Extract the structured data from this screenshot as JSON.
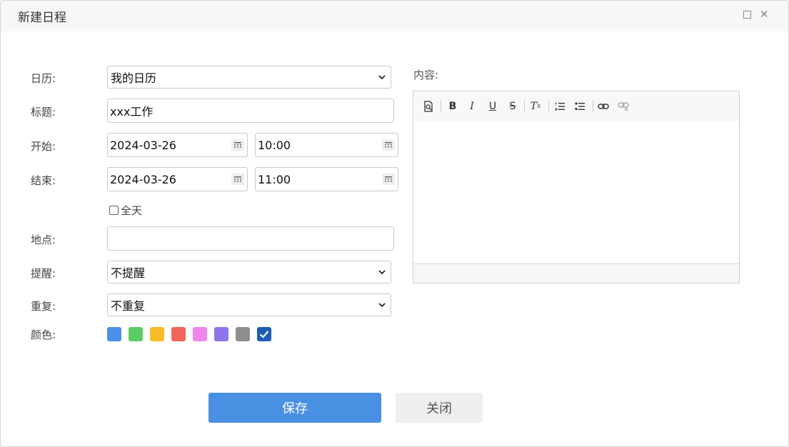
{
  "dialog": {
    "title": "新建日程"
  },
  "form": {
    "calendar": {
      "label": "日历:",
      "value": "我的日历"
    },
    "subject": {
      "label": "标题:",
      "value": "xxx工作"
    },
    "start": {
      "label": "开始:",
      "date": "2024-03-26",
      "time": "10:00"
    },
    "end": {
      "label": "结束:",
      "date": "2024-03-26",
      "time": "11:00"
    },
    "allday": {
      "label": "全天",
      "checked": false
    },
    "location": {
      "label": "地点:",
      "value": ""
    },
    "reminder": {
      "label": "提醒:",
      "value": "不提醒"
    },
    "repeat": {
      "label": "重复:",
      "value": "不重复"
    },
    "color": {
      "label": "颜色:",
      "options": [
        "#4a90ea",
        "#5ccd65",
        "#f9bb27",
        "#f1635c",
        "#ef86ee",
        "#8e74ec",
        "#8e8e8e",
        "#1e5db4"
      ],
      "selected": "#1e5db4"
    }
  },
  "editor": {
    "label": "内容:",
    "toolbar": [
      "preview-icon",
      "bold-icon",
      "italic-icon",
      "underline-icon",
      "strikethrough-icon",
      "remove-format-icon",
      "ordered-list-icon",
      "bullet-list-icon",
      "link-icon",
      "unlink-icon"
    ]
  },
  "buttons": {
    "save": "保存",
    "close": "关闭"
  }
}
